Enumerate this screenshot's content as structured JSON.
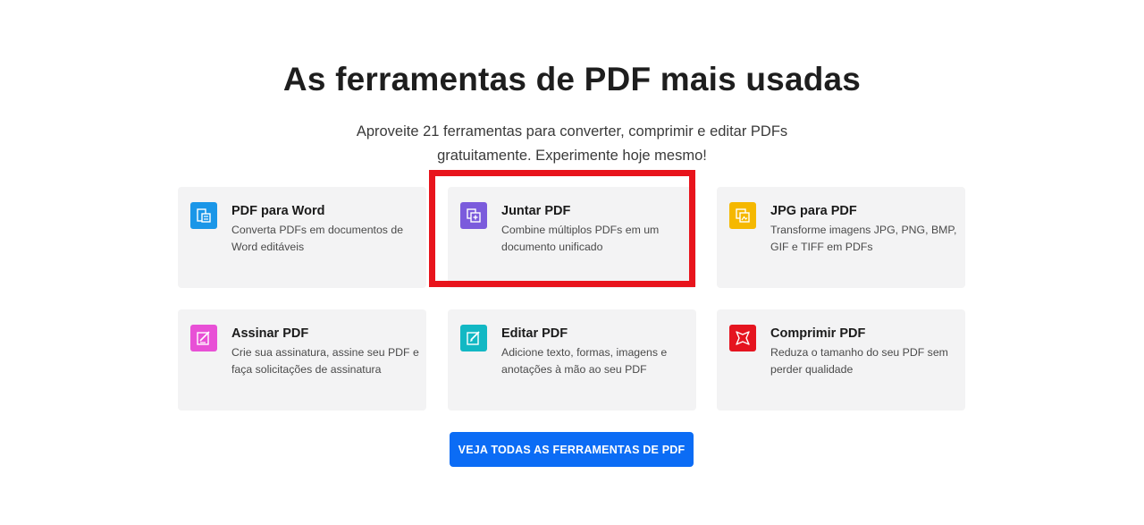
{
  "header": {
    "title": "As ferramentas de PDF mais usadas",
    "subtitle": "Aproveite 21 ferramentas para converter, comprimir e editar PDFs gratuitamente. Experimente hoje mesmo!"
  },
  "tools": [
    {
      "title": "PDF para Word",
      "description": "Converta PDFs em documentos de Word editáveis",
      "icon": "word-document-icon",
      "color": "#1a96e8"
    },
    {
      "title": "Juntar PDF",
      "description": "Combine múltiplos PDFs em um documento unificado",
      "icon": "merge-pages-icon",
      "color": "#7b5bdc"
    },
    {
      "title": "JPG para PDF",
      "description": "Transforme imagens JPG, PNG, BMP, GIF e TIFF em PDFs",
      "icon": "image-convert-icon",
      "color": "#f5b800"
    },
    {
      "title": "Assinar PDF",
      "description": "Crie sua assinatura, assine seu PDF e faça solicitações de assinatura",
      "icon": "signature-icon",
      "color": "#e850d6"
    },
    {
      "title": "Editar PDF",
      "description": "Adicione texto, formas, imagens e anotações à mão ao seu PDF",
      "icon": "edit-pencil-icon",
      "color": "#12b8c4"
    },
    {
      "title": "Comprimir PDF",
      "description": "Reduza o tamanho do seu PDF sem perder qualidade",
      "icon": "compress-icon",
      "color": "#e5141f"
    }
  ],
  "cta": {
    "label": "VEJA TODAS AS FERRAMENTAS DE PDF",
    "color": "#0b6cf5"
  },
  "highlight_color": "#e8141c"
}
